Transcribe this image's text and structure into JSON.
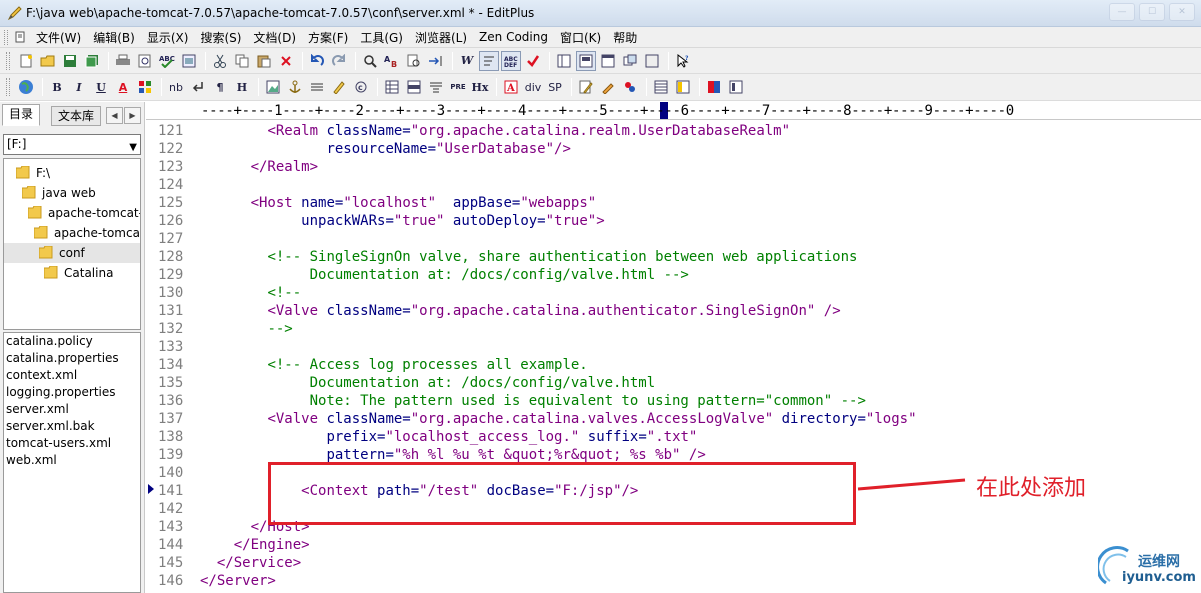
{
  "window": {
    "title": "F:\\java web\\apache-tomcat-7.0.57\\apache-tomcat-7.0.57\\conf\\server.xml * - EditPlus"
  },
  "menu": [
    "文件(W)",
    "编辑(B)",
    "显示(X)",
    "搜索(S)",
    "文档(D)",
    "方案(F)",
    "工具(G)",
    "浏览器(L)",
    "Zen Coding",
    "窗口(K)",
    "帮助"
  ],
  "toolbar2_labels": {
    "bold": "B",
    "italic": "I",
    "underline": "U",
    "font": "A",
    "nb": "nb",
    "para": "¶",
    "h": "H",
    "pre": "PRE",
    "hx": "Hx",
    "div": "div",
    "sp": "SP",
    "w": "W"
  },
  "sidebar": {
    "tabs": [
      "目录",
      "文本库"
    ],
    "drive": "[F:]",
    "tree": [
      "F:\\",
      "java web",
      "apache-tomcat-",
      "apache-tomcat",
      "conf",
      "Catalina"
    ],
    "files": [
      "catalina.policy",
      "catalina.properties",
      "context.xml",
      "logging.properties",
      "server.xml",
      "server.xml.bak",
      "tomcat-users.xml",
      "web.xml"
    ]
  },
  "ruler": "----+----1----+----2----+----3----+----4----+----5----+----6----+----7----+----8----+----9----+----0",
  "editor": {
    "line_numbers": [
      "121",
      "122",
      "123",
      "124",
      "125",
      "126",
      "127",
      "128",
      "129",
      "130",
      "131",
      "132",
      "133",
      "134",
      "135",
      "136",
      "137",
      "138",
      "139",
      "140",
      "141",
      "142",
      "143",
      "144",
      "145",
      "146"
    ],
    "lines": [
      [
        {
          "t": "        "
        },
        {
          "c": "tg",
          "t": "<Realm "
        },
        {
          "c": "at",
          "t": "className="
        },
        {
          "c": "st",
          "t": "\"org.apache.catalina.realm.UserDatabaseRealm\""
        }
      ],
      [
        {
          "t": "               "
        },
        {
          "c": "at",
          "t": "resourceName="
        },
        {
          "c": "st",
          "t": "\"UserDatabase\""
        },
        {
          "c": "tg",
          "t": "/>"
        }
      ],
      [
        {
          "t": "      "
        },
        {
          "c": "tg",
          "t": "</Realm>"
        }
      ],
      [
        {
          "t": ""
        }
      ],
      [
        {
          "t": "      "
        },
        {
          "c": "tg",
          "t": "<Host "
        },
        {
          "c": "at",
          "t": "name="
        },
        {
          "c": "st",
          "t": "\"localhost\""
        },
        {
          "t": "  "
        },
        {
          "c": "at",
          "t": "appBase="
        },
        {
          "c": "st",
          "t": "\"webapps\""
        }
      ],
      [
        {
          "t": "            "
        },
        {
          "c": "at",
          "t": "unpackWARs="
        },
        {
          "c": "st",
          "t": "\"true\""
        },
        {
          "t": " "
        },
        {
          "c": "at",
          "t": "autoDeploy="
        },
        {
          "c": "st",
          "t": "\"true\""
        },
        {
          "c": "tg",
          "t": ">"
        }
      ],
      [
        {
          "t": ""
        }
      ],
      [
        {
          "t": "        "
        },
        {
          "c": "cm",
          "t": "<!-- SingleSignOn valve, share authentication between web applications"
        }
      ],
      [
        {
          "c": "cm",
          "t": "             Documentation at: /docs/config/valve.html -->"
        }
      ],
      [
        {
          "t": "        "
        },
        {
          "c": "cm",
          "t": "<!--"
        }
      ],
      [
        {
          "t": "        "
        },
        {
          "c": "tg",
          "t": "<Valve "
        },
        {
          "c": "at",
          "t": "className="
        },
        {
          "c": "st",
          "t": "\"org.apache.catalina.authenticator.SingleSignOn\""
        },
        {
          "t": " "
        },
        {
          "c": "tg",
          "t": "/>"
        }
      ],
      [
        {
          "t": "        "
        },
        {
          "c": "cm",
          "t": "-->"
        }
      ],
      [
        {
          "t": ""
        }
      ],
      [
        {
          "t": "        "
        },
        {
          "c": "cm",
          "t": "<!-- Access log processes all example."
        }
      ],
      [
        {
          "c": "cm",
          "t": "             Documentation at: /docs/config/valve.html"
        }
      ],
      [
        {
          "c": "cm",
          "t": "             Note: The pattern used is equivalent to using pattern=\"common\" -->"
        }
      ],
      [
        {
          "t": "        "
        },
        {
          "c": "tg",
          "t": "<Valve "
        },
        {
          "c": "at",
          "t": "className="
        },
        {
          "c": "st",
          "t": "\"org.apache.catalina.valves.AccessLogValve\""
        },
        {
          "t": " "
        },
        {
          "c": "at",
          "t": "directory="
        },
        {
          "c": "st",
          "t": "\"logs\""
        }
      ],
      [
        {
          "t": "               "
        },
        {
          "c": "at",
          "t": "prefix="
        },
        {
          "c": "st",
          "t": "\"localhost_access_log.\""
        },
        {
          "t": " "
        },
        {
          "c": "at",
          "t": "suffix="
        },
        {
          "c": "st",
          "t": "\".txt\""
        }
      ],
      [
        {
          "t": "               "
        },
        {
          "c": "at",
          "t": "pattern="
        },
        {
          "c": "st",
          "t": "\"%h %l %u %t &quot;%r&quot; %s %b\""
        },
        {
          "t": " "
        },
        {
          "c": "tg",
          "t": "/>"
        }
      ],
      [
        {
          "t": ""
        }
      ],
      [
        {
          "t": "            "
        },
        {
          "c": "tg",
          "t": "<Context "
        },
        {
          "c": "at",
          "t": "path="
        },
        {
          "c": "st",
          "t": "\"/test\""
        },
        {
          "t": " "
        },
        {
          "c": "at",
          "t": "docBase="
        },
        {
          "c": "st",
          "t": "\"F:/jsp\""
        },
        {
          "c": "tg",
          "t": "/>"
        }
      ],
      [
        {
          "t": ""
        }
      ],
      [
        {
          "t": "      "
        },
        {
          "c": "tg",
          "t": "</Host>"
        }
      ],
      [
        {
          "t": "    "
        },
        {
          "c": "tg",
          "t": "</Engine>"
        }
      ],
      [
        {
          "t": "  "
        },
        {
          "c": "tg",
          "t": "</Service>"
        }
      ],
      [
        {
          "c": "tg",
          "t": "</Server>"
        }
      ]
    ]
  },
  "annotation": {
    "text": "在此处添加",
    "color": "#e0202a"
  },
  "watermark": {
    "text1": "运维网",
    "text2": "iyunv.com"
  },
  "colors": {
    "tag": "#800080",
    "attribute": "#000080",
    "string": "#800080",
    "comment": "#008000",
    "line_number": "#7f7f7f"
  }
}
